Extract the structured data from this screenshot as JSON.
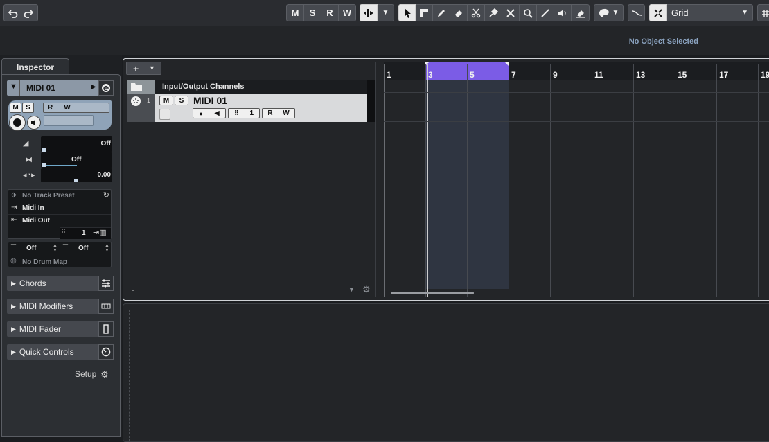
{
  "toolbar": {
    "mute_label": "M",
    "solo_label": "S",
    "read_label": "R",
    "write_label": "W",
    "snap_type": "Grid"
  },
  "status": {
    "selection": "No Object Selected"
  },
  "inspector": {
    "tab_label": "Inspector",
    "track_name": "MIDI 01",
    "mute": "M",
    "solo": "S",
    "read": "R",
    "write": "W",
    "volume_value": "Off",
    "pan_value": "Off",
    "delay_value": "0.00",
    "track_preset": "No Track Preset",
    "midi_in": "Midi In",
    "midi_out": "Midi Out",
    "channel": "1",
    "bank_value": "Off",
    "program_value": "Off",
    "drum_map": "No Drum Map",
    "sections": [
      "Chords",
      "MIDI Modifiers",
      "MIDI Fader",
      "Quick Controls"
    ],
    "setup_label": "Setup"
  },
  "tracklist": {
    "add_label": "+",
    "folder_track": "Input/Output Channels",
    "track_number": "1",
    "track_name": "MIDI 01",
    "mute": "M",
    "solo": "S",
    "read": "R",
    "write": "W",
    "channel": "1",
    "minus": "-"
  },
  "ruler": {
    "bars": [
      "1",
      "3",
      "5",
      "7",
      "9",
      "11",
      "13",
      "15",
      "17",
      "19"
    ]
  },
  "colors": {
    "cycle_range": "#7b5ce6",
    "accent": "#8ba3c0"
  }
}
